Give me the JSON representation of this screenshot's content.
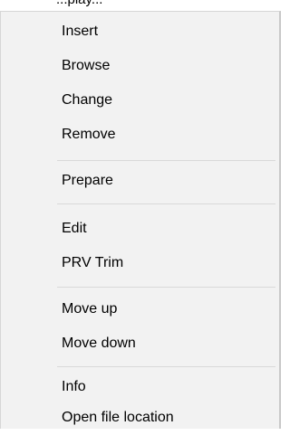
{
  "header_fragment": "...play...",
  "menu": {
    "groups": [
      {
        "items": [
          {
            "label": "Insert"
          },
          {
            "label": "Browse"
          },
          {
            "label": "Change"
          },
          {
            "label": "Remove"
          }
        ]
      },
      {
        "items": [
          {
            "label": "Prepare"
          }
        ]
      },
      {
        "items": [
          {
            "label": "Edit"
          },
          {
            "label": "PRV  Trim"
          }
        ]
      },
      {
        "items": [
          {
            "label": "Move up"
          },
          {
            "label": "Move down"
          }
        ]
      },
      {
        "items": [
          {
            "label": "Info"
          },
          {
            "label": "Open file location"
          }
        ]
      }
    ]
  }
}
